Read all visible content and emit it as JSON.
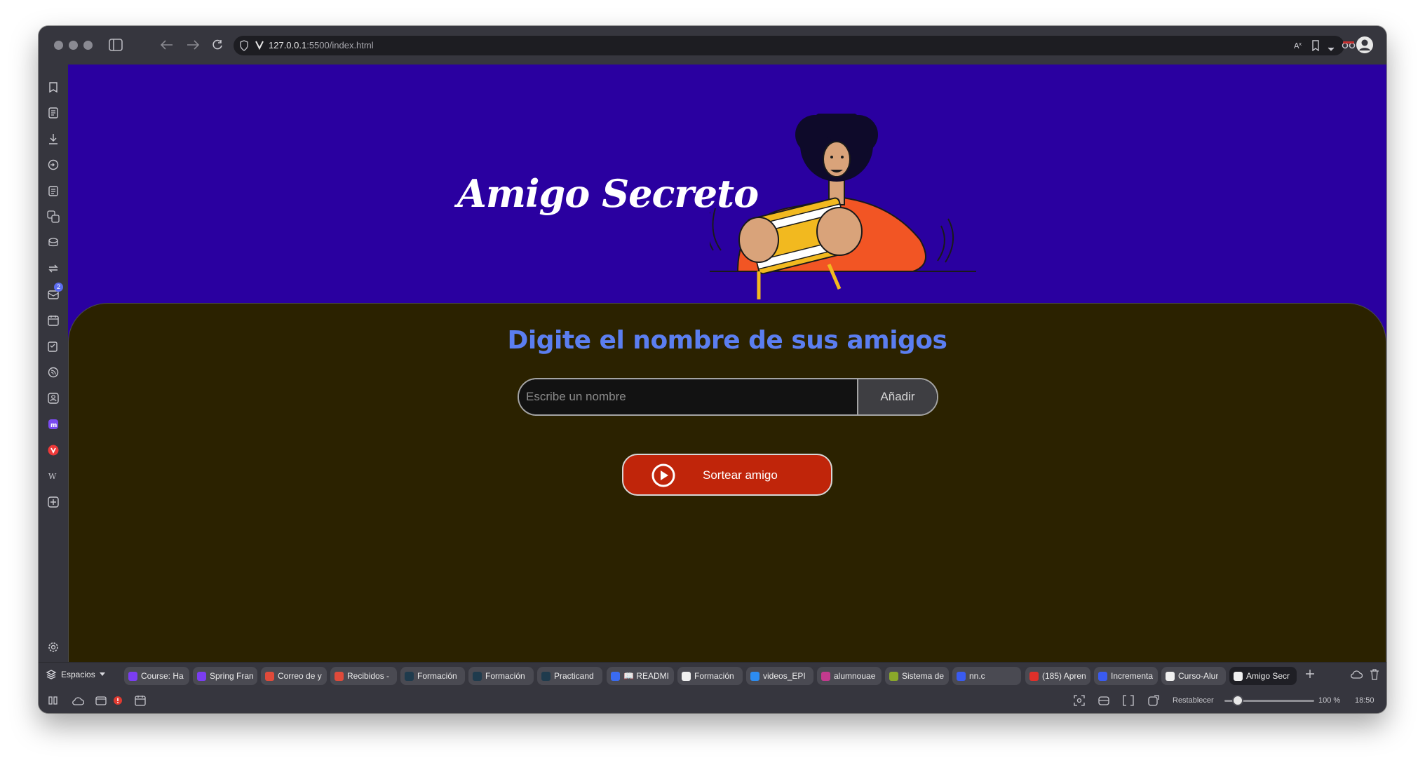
{
  "browser": {
    "url_host": "127.0.0.1",
    "url_rest": ":5500/index.html"
  },
  "page": {
    "title": "Amigo Secreto",
    "subtitle": "Digite el nombre de sus amigos",
    "input_placeholder": "Escribe un nombre",
    "add_button": "Añadir",
    "draw_button": "Sortear amigo"
  },
  "sidebar": {
    "mail_badge": "2"
  },
  "tabbar": {
    "spaces_label": "Espacios",
    "tabs": [
      {
        "label": "Course: Ha",
        "color": "#7b3df2"
      },
      {
        "label": "Spring Fran",
        "color": "#7b3df2"
      },
      {
        "label": "Correo de y",
        "color": "#e04a3a"
      },
      {
        "label": "Recibidos -",
        "color": "#e04a3a"
      },
      {
        "label": "Formación",
        "color": "#1f3b4d"
      },
      {
        "label": "Formación",
        "color": "#1f3b4d"
      },
      {
        "label": "Practicand",
        "color": "#1f3b4d"
      },
      {
        "label": "📖 READMI",
        "color": "#3a6bf0"
      },
      {
        "label": "Formación",
        "color": "#f0f0f0"
      },
      {
        "label": "videos_EPI",
        "color": "#2d8cf0"
      },
      {
        "label": "alumnouae",
        "color": "#c23a8e"
      },
      {
        "label": "Sistema de",
        "color": "#8aa82a"
      },
      {
        "label": "nn.c",
        "color": "#3a5bf0"
      },
      {
        "label": "(185) Apren",
        "color": "#e0302a"
      },
      {
        "label": "Incrementa",
        "color": "#3a5bf0"
      },
      {
        "label": "Curso-Alur",
        "color": "#f0f0f0"
      },
      {
        "label": "Amigo Secr",
        "color": "#f0f0f0"
      }
    ]
  },
  "statusbar": {
    "reset_label": "Restablecer",
    "zoom": "100 %",
    "zoom_fraction": 0.15,
    "time": "18:50"
  }
}
